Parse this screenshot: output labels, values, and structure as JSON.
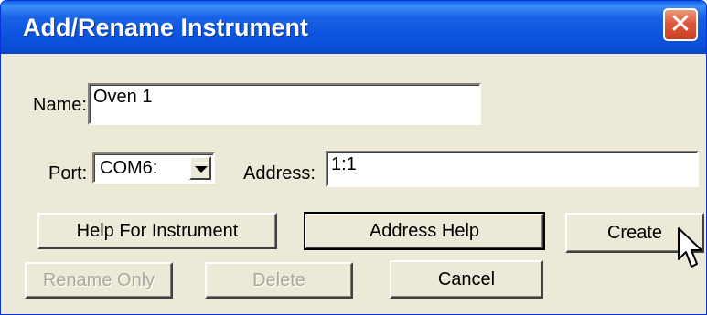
{
  "window": {
    "title": "Add/Rename Instrument",
    "close_icon": "close-icon"
  },
  "form": {
    "name_label": "Name:",
    "name_value": "Oven 1",
    "port_label": "Port:",
    "port_value": "COM6:",
    "address_label": "Address:",
    "address_value": "1:1"
  },
  "buttons": {
    "help_instrument": "Help For Instrument",
    "address_help": "Address Help",
    "create": "Create",
    "rename_only": "Rename Only",
    "delete": "Delete",
    "cancel": "Cancel"
  },
  "colors": {
    "titlebar": "#0b55df",
    "dialog_bg": "#ece9d8",
    "close": "#e0583a"
  }
}
